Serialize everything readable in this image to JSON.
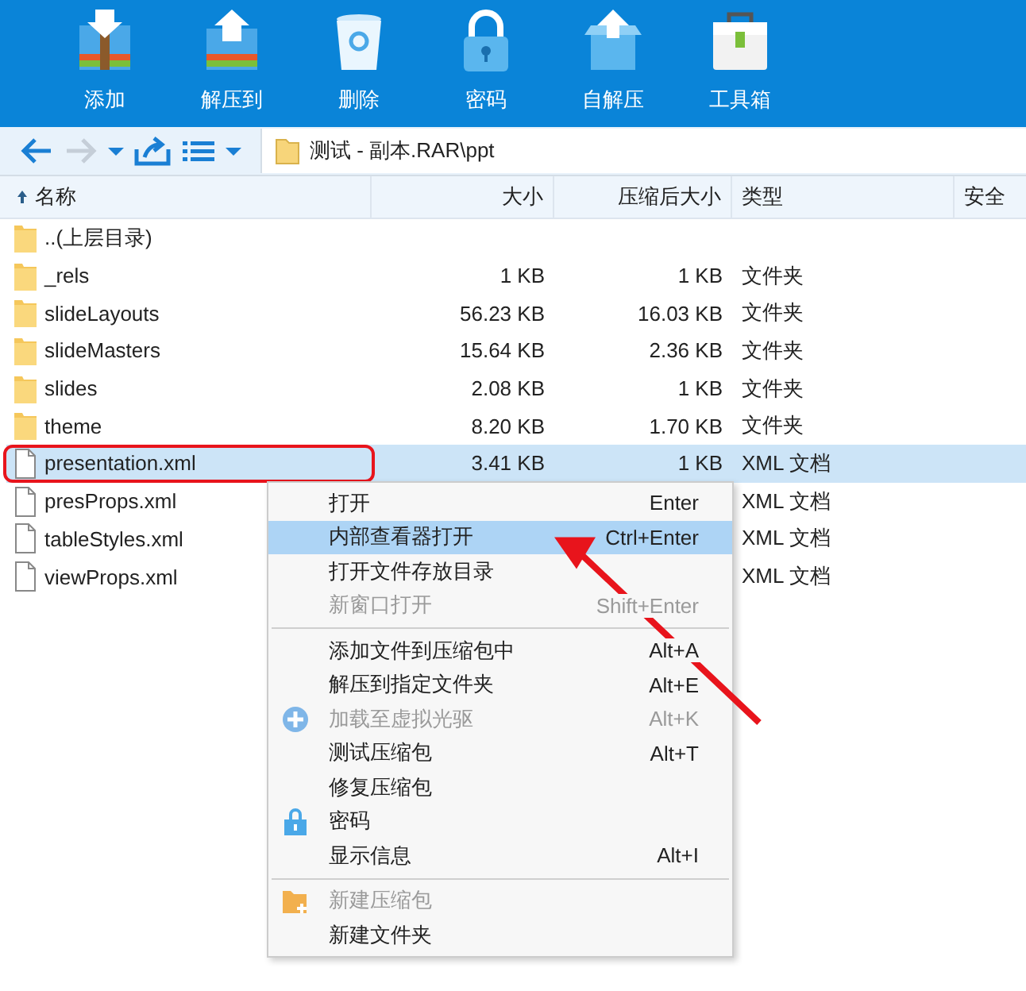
{
  "toolbar": [
    {
      "label": "添加"
    },
    {
      "label": "解压到"
    },
    {
      "label": "删除"
    },
    {
      "label": "密码"
    },
    {
      "label": "自解压"
    },
    {
      "label": "工具箱"
    }
  ],
  "address": {
    "path": "测试 - 副本.RAR\\ppt"
  },
  "table": {
    "columns": [
      {
        "label": "名称",
        "sorted": true
      },
      {
        "label": "大小",
        "sorted": false
      },
      {
        "label": "压缩后大小",
        "sorted": false
      },
      {
        "label": "类型",
        "sorted": false
      },
      {
        "label": "安全",
        "sorted": false
      }
    ],
    "rows": [
      {
        "kind": "folder",
        "name": "..(上层目录)",
        "selected": false,
        "outlined": false
      },
      {
        "kind": "folder",
        "name": "_rels",
        "size": "1 KB",
        "packed": "1 KB",
        "type": "文件夹",
        "selected": false,
        "outlined": false
      },
      {
        "kind": "folder",
        "name": "slideLayouts",
        "size": "56.23 KB",
        "packed": "16.03 KB",
        "type": "文件夹",
        "selected": false,
        "outlined": false
      },
      {
        "kind": "folder",
        "name": "slideMasters",
        "size": "15.64 KB",
        "packed": "2.36 KB",
        "type": "文件夹",
        "selected": false,
        "outlined": false
      },
      {
        "kind": "folder",
        "name": "slides",
        "size": "2.08 KB",
        "packed": "1 KB",
        "type": "文件夹",
        "selected": false,
        "outlined": false
      },
      {
        "kind": "folder",
        "name": "theme",
        "size": "8.20 KB",
        "packed": "1.70 KB",
        "type": "文件夹",
        "selected": false,
        "outlined": false
      },
      {
        "kind": "file",
        "name": "presentation.xml",
        "size": "3.41 KB",
        "packed": "1 KB",
        "type": "XML 文档",
        "selected": true,
        "outlined": true
      },
      {
        "kind": "file",
        "name": "presProps.xml",
        "type": "XML 文档",
        "selected": false,
        "outlined": false
      },
      {
        "kind": "file",
        "name": "tableStyles.xml",
        "type": "XML 文档",
        "selected": false,
        "outlined": false
      },
      {
        "kind": "file",
        "name": "viewProps.xml",
        "type": "XML 文档",
        "selected": false,
        "outlined": false
      }
    ]
  },
  "context_menu": [
    {
      "kind": "item",
      "label": "打开",
      "shortcut": "Enter",
      "disabled": false,
      "selected": false,
      "pointed_at": false
    },
    {
      "kind": "item",
      "label": "内部查看器打开",
      "shortcut": "Ctrl+Enter",
      "disabled": false,
      "selected": true,
      "pointed_at": true
    },
    {
      "kind": "item",
      "label": "打开文件存放目录",
      "disabled": false,
      "selected": false,
      "pointed_at": false
    },
    {
      "kind": "item",
      "label": "新窗口打开",
      "shortcut": "Shift+Enter",
      "disabled": true,
      "selected": false,
      "pointed_at": false
    },
    {
      "kind": "separator"
    },
    {
      "kind": "item",
      "label": "添加文件到压缩包中",
      "shortcut": "Alt+A",
      "disabled": false,
      "selected": false,
      "pointed_at": false
    },
    {
      "kind": "item",
      "label": "解压到指定文件夹",
      "shortcut": "Alt+E",
      "disabled": false,
      "selected": false,
      "pointed_at": false
    },
    {
      "kind": "plus-item",
      "label": "加载至虚拟光驱",
      "shortcut": "Alt+K",
      "disabled": true,
      "selected": false,
      "pointed_at": false
    },
    {
      "kind": "item",
      "label": "测试压缩包",
      "shortcut": "Alt+T",
      "disabled": false,
      "selected": false,
      "pointed_at": false
    },
    {
      "kind": "item",
      "label": "修复压缩包",
      "disabled": false,
      "selected": false,
      "pointed_at": false
    },
    {
      "kind": "lock-item",
      "label": "密码",
      "disabled": false,
      "selected": false,
      "pointed_at": false
    },
    {
      "kind": "item",
      "label": "显示信息",
      "shortcut": "Alt+I",
      "disabled": false,
      "selected": false,
      "pointed_at": false
    },
    {
      "kind": "separator"
    },
    {
      "kind": "new-folder-item",
      "label": "新建压缩包",
      "disabled": true,
      "selected": false,
      "pointed_at": false
    },
    {
      "kind": "item",
      "label": "新建文件夹",
      "disabled": false,
      "selected": false,
      "pointed_at": false
    }
  ]
}
